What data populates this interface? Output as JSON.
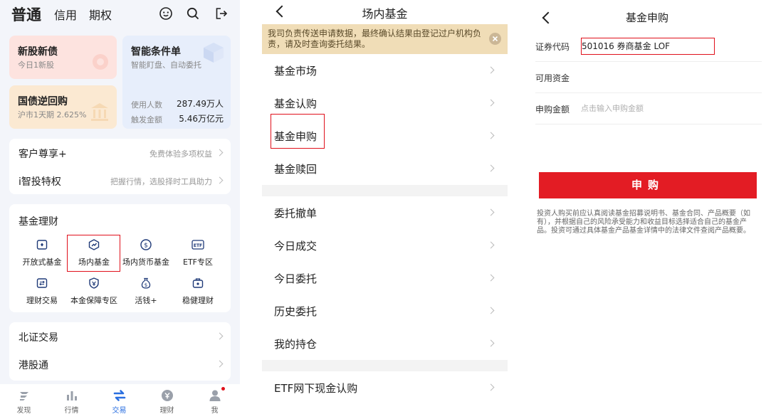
{
  "panel1": {
    "tabs": [
      {
        "label": "普通",
        "active": true
      },
      {
        "label": "信用",
        "active": false
      },
      {
        "label": "期权",
        "active": false
      }
    ],
    "header_icons": [
      "smiley-icon",
      "search-icon",
      "exit-icon"
    ],
    "ipo_card": {
      "title": "新股新债",
      "subtitle": "今日1新股"
    },
    "repo_card": {
      "title": "国债逆回购",
      "subtitle": "沪市1天期 2.625%"
    },
    "smart_order_card": {
      "title": "智能条件单",
      "subtitle": "智能盯盘、自动委托",
      "users_label": "使用人数",
      "users_value": "287.49万人",
      "amount_label": "触发金额",
      "amount_value": "5.46万亿元"
    },
    "vip_rows": [
      {
        "label": "客户尊享+",
        "sub": "免费体验多项权益"
      },
      {
        "label": "i智投特权",
        "sub": "把握行情，选股择时工具助力"
      }
    ],
    "fund_section": {
      "title": "基金理财",
      "items": [
        {
          "label": "开放式基金",
          "icon": "open-fund-icon"
        },
        {
          "label": "场内基金",
          "icon": "exchange-fund-icon",
          "highlighted": true
        },
        {
          "label": "场内货币基金",
          "icon": "money-fund-icon"
        },
        {
          "label": "ETF专区",
          "icon": "etf-icon",
          "icon_text": "ETF"
        },
        {
          "label": "理财交易",
          "icon": "wealth-trade-icon"
        },
        {
          "label": "本金保障专区",
          "icon": "principal-guarantee-icon"
        },
        {
          "label": "活钱+",
          "icon": "cash-plus-icon"
        },
        {
          "label": "稳健理财",
          "icon": "stable-wealth-icon"
        }
      ]
    },
    "market_rows": [
      {
        "label": "北证交易"
      },
      {
        "label": "港股通"
      }
    ],
    "bottom_nav": [
      {
        "label": "发现",
        "icon": "discover-icon",
        "active": false
      },
      {
        "label": "行情",
        "icon": "quotes-icon",
        "active": false
      },
      {
        "label": "交易",
        "icon": "trade-icon",
        "active": true
      },
      {
        "label": "理财",
        "icon": "wealth-icon",
        "active": false
      },
      {
        "label": "我",
        "icon": "profile-icon",
        "active": false,
        "badge": true
      }
    ],
    "colors": {
      "accent": "#2a6fe0",
      "highlight": "#e0101b",
      "badge": "#e0101b"
    }
  },
  "panel2": {
    "title": "场内基金",
    "notice": "我司负责传送申请数据，最终确认结果由登记过户机构负责，请及时查询委托结果。",
    "group1": [
      {
        "label": "基金市场"
      },
      {
        "label": "基金认购"
      },
      {
        "label": "基金申购",
        "highlighted": true
      },
      {
        "label": "基金赎回"
      }
    ],
    "group2": [
      {
        "label": "委托撤单"
      },
      {
        "label": "今日成交"
      },
      {
        "label": "今日委托"
      },
      {
        "label": "历史委托"
      },
      {
        "label": "我的持仓"
      }
    ],
    "group3": [
      {
        "label": "ETF网下现金认购"
      }
    ]
  },
  "panel3": {
    "title": "基金申购",
    "code_label": "证券代码",
    "code_value": "501016  券商基金 LOF",
    "funds_label": "可用资金",
    "funds_value": "",
    "amount_label": "申购金额",
    "amount_placeholder": "点击输入申购金额",
    "buy_button": "申购",
    "disclaimer": "投资人购买前应认真阅读基金招募说明书、基金合同、产品概要（如有），并根据自己的风险承受能力和收益目标选择适合自己的基金产品。投资可通过具体基金产品基金详情中的法律文件查阅产品概要。",
    "colors": {
      "button": "#e31c24",
      "highlight": "#e0101b"
    }
  }
}
